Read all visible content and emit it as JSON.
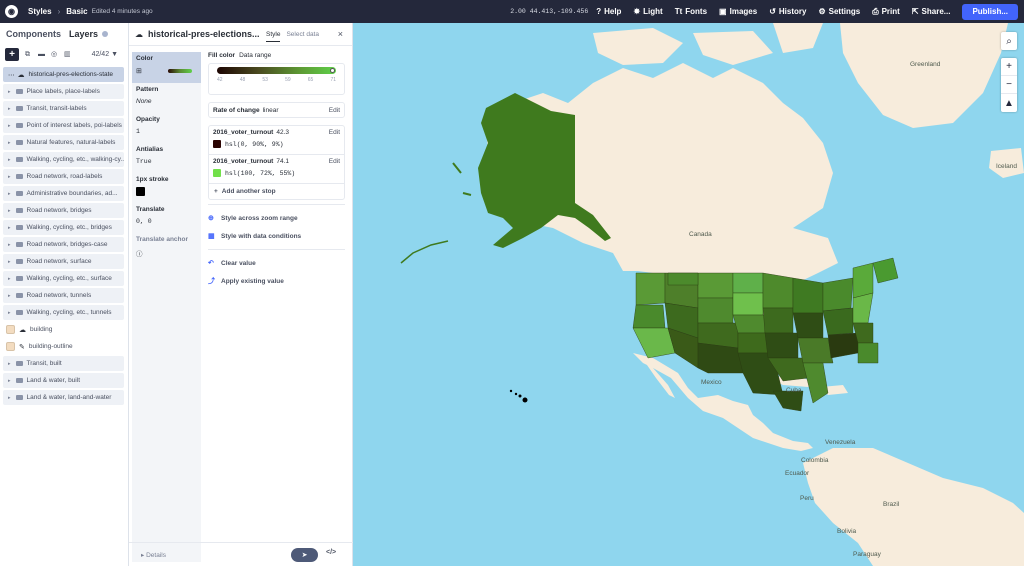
{
  "topbar": {
    "logo": "mapbox-logo",
    "styles_label": "Styles",
    "separator": "›",
    "style_name": "Basic",
    "edited": "Edited 4 minutes ago",
    "coords": "2.00 44.413,-109.456",
    "items": [
      {
        "icon": "?",
        "icon_name": "help-icon",
        "label": "Help"
      },
      {
        "icon": "✸",
        "icon_name": "sun-icon",
        "label": "Light"
      },
      {
        "icon": "Tt",
        "icon_name": "fonts-icon",
        "label": "Fonts"
      },
      {
        "icon": "▣",
        "icon_name": "images-icon",
        "label": "Images"
      },
      {
        "icon": "↺",
        "icon_name": "history-icon",
        "label": "History"
      },
      {
        "icon": "⚙",
        "icon_name": "gear-icon",
        "label": "Settings"
      },
      {
        "icon": "⎙",
        "icon_name": "print-icon",
        "label": "Print"
      },
      {
        "icon": "⇱",
        "icon_name": "share-icon",
        "label": "Share..."
      }
    ],
    "publish": "Publish..."
  },
  "sidebar": {
    "tab_components": "Components",
    "tab_layers": "Layers",
    "count": "42/42",
    "layers": [
      {
        "label": "historical-pres-elections-state",
        "type": "selected"
      },
      {
        "label": "Place labels, place-labels",
        "type": "group"
      },
      {
        "label": "Transit, transit-labels",
        "type": "group"
      },
      {
        "label": "Point of interest labels, poi-labels",
        "type": "group"
      },
      {
        "label": "Natural features, natural-labels",
        "type": "group"
      },
      {
        "label": "Walking, cycling, etc., walking-cy...",
        "type": "group"
      },
      {
        "label": "Road network, road-labels",
        "type": "group"
      },
      {
        "label": "Administrative boundaries, ad...",
        "type": "group"
      },
      {
        "label": "Road network, bridges",
        "type": "group"
      },
      {
        "label": "Walking, cycling, etc., bridges",
        "type": "group"
      },
      {
        "label": "Road network, bridges-case",
        "type": "group"
      },
      {
        "label": "Road network, surface",
        "type": "group"
      },
      {
        "label": "Walking, cycling, etc., surface",
        "type": "group"
      },
      {
        "label": "Road network, tunnels",
        "type": "group"
      },
      {
        "label": "Walking, cycling, etc., tunnels",
        "type": "group"
      },
      {
        "label": "building",
        "type": "leaf-fill"
      },
      {
        "label": "building-outline",
        "type": "leaf-line"
      },
      {
        "label": "Transit, built",
        "type": "group"
      },
      {
        "label": "Land & water, built",
        "type": "group"
      },
      {
        "label": "Land & water, land-and-water",
        "type": "group"
      }
    ]
  },
  "editor": {
    "title": "historical-pres-elections...",
    "tab_style": "Style",
    "tab_select": "Select data",
    "close": "×",
    "props": {
      "color": "Color",
      "pattern": "Pattern",
      "pattern_val": "None",
      "opacity": "Opacity",
      "opacity_val": "1",
      "antialias": "Antialias",
      "antialias_val": "True",
      "stroke": "1px stroke",
      "translate": "Translate",
      "translate_val": "0, 0",
      "translate_anchor": "Translate anchor"
    },
    "fill_color": "Fill color",
    "data_range": "Data range",
    "ramp_ticks": [
      "42",
      "48",
      "53",
      "59",
      "65",
      "71"
    ],
    "rate_label": "Rate of change",
    "rate_val": "linear",
    "edit": "Edit",
    "stops": [
      {
        "field": "2016_voter_turnout",
        "value": "42.3",
        "color_text": "hsl(0, 90%, 9%)",
        "color": "#2b0402"
      },
      {
        "field": "2016_voter_turnout",
        "value": "74.1",
        "color_text": "hsl(100, 72%, 55%)",
        "color": "#72e04a"
      }
    ],
    "add_stop": "Add another stop",
    "actions": {
      "zoom_range": "Style across zoom range",
      "data_conditions": "Style with data conditions",
      "clear": "Clear value",
      "apply": "Apply existing value"
    },
    "details": "Details",
    "code": "</>"
  },
  "map": {
    "labels": {
      "greenland": "Greenland",
      "iceland": "Iceland",
      "canada": "Canada",
      "mexico": "Mexico",
      "cuba": "Cuba",
      "venezuela": "Venezuela",
      "colombia": "Colombia",
      "ecuador": "Ecuador",
      "peru": "Peru",
      "brazil": "Brazil",
      "bolivia": "Bolivia",
      "paraguay": "Paraguay"
    },
    "colors": {
      "water": "#8fd6ee",
      "land": "#f7ecdc",
      "data_dark": "#2f4a14",
      "data_light": "#6fd04a"
    }
  }
}
